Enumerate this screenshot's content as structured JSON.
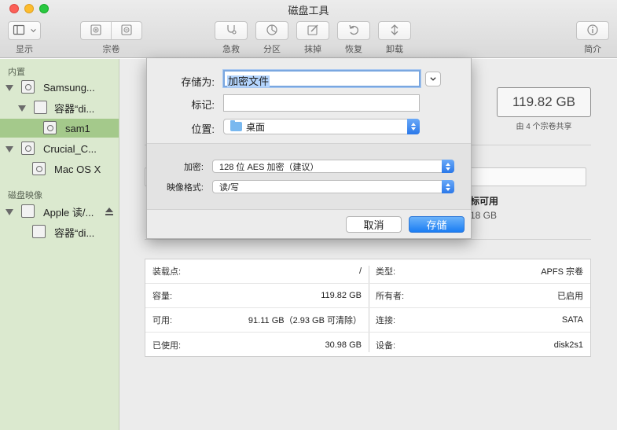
{
  "window": {
    "title": "磁盘工具"
  },
  "toolbar": {
    "display_label": "显示",
    "volume_label": "宗卷",
    "firstaid_label": "急救",
    "partition_label": "分区",
    "erase_label": "抹掉",
    "restore_label": "恢复",
    "unmount_label": "卸载",
    "info_label": "简介"
  },
  "sidebar": {
    "section_internal": "内置",
    "section_images": "磁盘映像",
    "items": [
      {
        "label": "Samsung..."
      },
      {
        "label": "容器“di..."
      },
      {
        "label": "sam1"
      },
      {
        "label": "Crucial_C..."
      },
      {
        "label": "Mac OS X"
      },
      {
        "label": "Apple 读/..."
      },
      {
        "label": "容器“di..."
      }
    ],
    "selected_index": 2
  },
  "main": {
    "capacity": "119.82 GB",
    "capacity_shared": "由 4 个宗卷共享",
    "partial_label": "标可用",
    "partial_value": "18 GB",
    "info": {
      "left": [
        {
          "key": "装载点:",
          "value": "/"
        },
        {
          "key": "容量:",
          "value": "119.82 GB"
        },
        {
          "key": "可用:",
          "value": "91.11 GB（2.93 GB 可清除）"
        },
        {
          "key": "已使用:",
          "value": "30.98 GB"
        }
      ],
      "right": [
        {
          "key": "类型:",
          "value": "APFS 宗卷"
        },
        {
          "key": "所有者:",
          "value": "已启用"
        },
        {
          "key": "连接:",
          "value": "SATA"
        },
        {
          "key": "设备:",
          "value": "disk2s1"
        }
      ]
    }
  },
  "sheet": {
    "save_as_label": "存储为:",
    "save_as_value": "加密文件",
    "tags_label": "标记:",
    "tags_value": "",
    "where_label": "位置:",
    "where_value": "桌面",
    "encryption_label": "加密:",
    "encryption_value": "128 位 AES 加密（建议）",
    "format_label": "映像格式:",
    "format_value": "读/写",
    "cancel_label": "取消",
    "save_label": "存储"
  },
  "colors": {
    "sidebar_bg": "#dbe9cf",
    "sidebar_selected": "#a4c98b",
    "accent_blue": "#1b7df3"
  }
}
